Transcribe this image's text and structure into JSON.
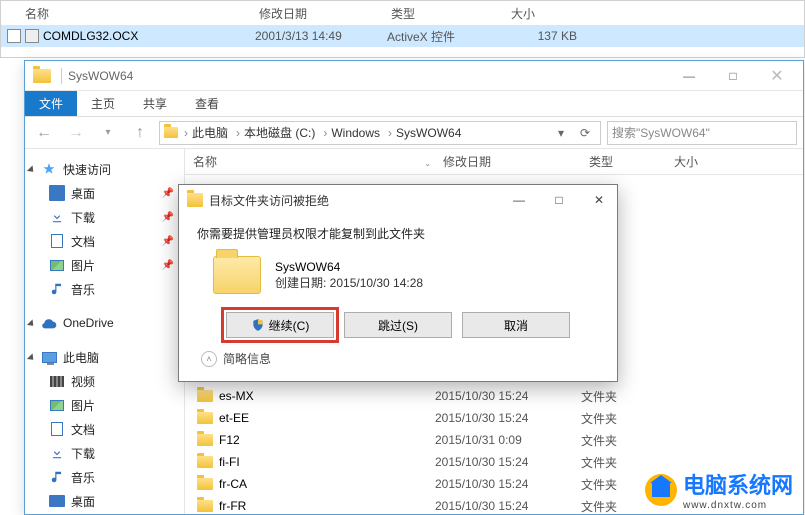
{
  "top_list": {
    "headers": {
      "name": "名称",
      "date": "修改日期",
      "type": "类型",
      "size": "大小"
    },
    "row": {
      "name": "COMDLG32.OCX",
      "date": "2001/3/13 14:49",
      "type": "ActiveX 控件",
      "size": "137 KB"
    }
  },
  "explorer": {
    "title": "SysWOW64",
    "tabs": {
      "file": "文件",
      "home": "主页",
      "share": "共享",
      "view": "查看"
    },
    "breadcrumb": [
      "此电脑",
      "本地磁盘 (C:)",
      "Windows",
      "SysWOW64"
    ],
    "search_placeholder": "搜索\"SysWOW64\"",
    "sidebar": {
      "quick": {
        "head": "快速访问",
        "items": [
          "桌面",
          "下载",
          "文档",
          "图片",
          "音乐"
        ]
      },
      "onedrive": "OneDrive",
      "pc": {
        "head": "此电脑",
        "items": [
          "视频",
          "图片",
          "文档",
          "下载",
          "音乐",
          "桌面"
        ]
      }
    },
    "columns": {
      "name": "名称",
      "date": "修改日期",
      "type": "类型",
      "size": "大小"
    },
    "rows": [
      {
        "name": "es-MX",
        "date": "2015/10/30 15:24",
        "type": "文件夹"
      },
      {
        "name": "et-EE",
        "date": "2015/10/30 15:24",
        "type": "文件夹"
      },
      {
        "name": "F12",
        "date": "2015/10/31 0:09",
        "type": "文件夹"
      },
      {
        "name": "fi-FI",
        "date": "2015/10/30 15:24",
        "type": "文件夹"
      },
      {
        "name": "fr-CA",
        "date": "2015/10/30 15:24",
        "type": "文件夹"
      },
      {
        "name": "fr-FR",
        "date": "2015/10/30 15:24",
        "type": "文件夹"
      }
    ]
  },
  "dialog": {
    "title": "目标文件夹访问被拒绝",
    "message": "你需要提供管理员权限才能复制到此文件夹",
    "folder_name": "SysWOW64",
    "created_label": "创建日期: 2015/10/30 14:28",
    "btn_continue": "继续(C)",
    "btn_skip": "跳过(S)",
    "btn_cancel": "取消",
    "more": "简略信息"
  },
  "logo": {
    "text": "电脑系统网",
    "sub": "www.dnxtw.com"
  }
}
